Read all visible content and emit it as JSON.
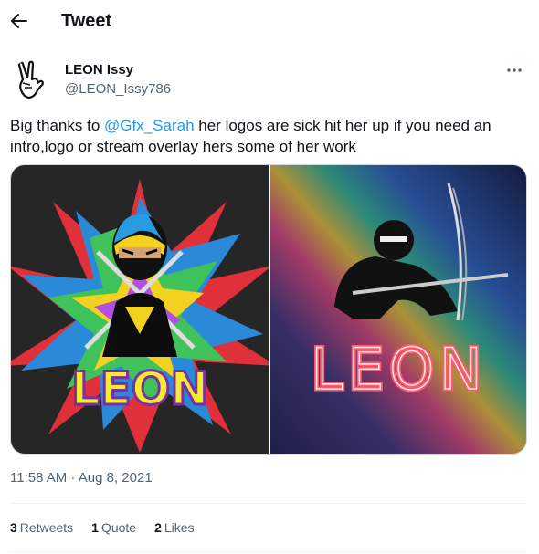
{
  "header": {
    "title": "Tweet"
  },
  "author": {
    "display_name": "LEON Issy",
    "handle": "@LEON_Issy786"
  },
  "tweet": {
    "text_before": "Big thanks to ",
    "mention": "@Gfx_Sarah",
    "text_after": " her logos are sick hit her up if you need an intro,logo or stream overlay hers some of her work",
    "images": [
      {
        "logo_text": "LEON",
        "style": "yellow ninja on colorful burst"
      },
      {
        "logo_text": "LEON",
        "style": "neon red ninja on rainbow gradient"
      }
    ],
    "timestamp": "11:58 AM · Aug 8, 2021"
  },
  "stats": {
    "retweets_count": "3",
    "retweets_label": "Retweets",
    "quotes_count": "1",
    "quotes_label": "Quote",
    "likes_count": "2",
    "likes_label": "Likes"
  },
  "colors": {
    "accent": "#1d9bf0",
    "muted": "#536471",
    "text": "#0f1419"
  }
}
